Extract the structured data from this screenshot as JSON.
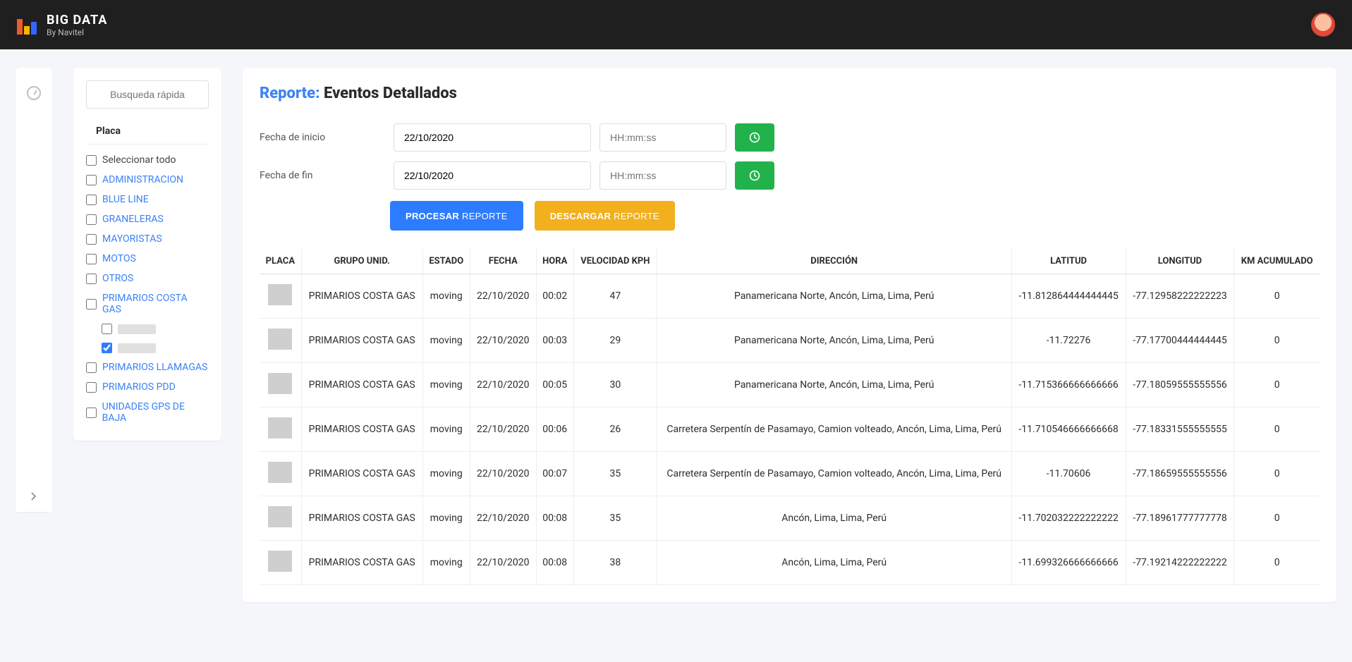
{
  "brand": {
    "title": "BIG DATA",
    "subtitle": "By Navitel"
  },
  "sidebar": {
    "search_placeholder": "Busqueda rápida",
    "section_title": "Placa",
    "items": [
      {
        "label": "Seleccionar todo",
        "checked": false,
        "plain": true
      },
      {
        "label": "ADMINISTRACION",
        "checked": false
      },
      {
        "label": "BLUE LINE",
        "checked": false
      },
      {
        "label": "GRANELERAS",
        "checked": false
      },
      {
        "label": "MAYORISTAS",
        "checked": false
      },
      {
        "label": "MOTOS",
        "checked": false
      },
      {
        "label": "OTROS",
        "checked": false
      },
      {
        "label": "PRIMARIOS COSTA GAS",
        "checked": false
      },
      {
        "label": "",
        "checked": false,
        "sub": true,
        "redacted": true,
        "redact_w": 54
      },
      {
        "label": "",
        "checked": true,
        "sub": true,
        "redacted": true,
        "redact_w": 54
      },
      {
        "label": "PRIMARIOS LLAMAGAS",
        "checked": false
      },
      {
        "label": "PRIMARIOS PDD",
        "checked": false
      },
      {
        "label": "UNIDADES GPS DE BAJA",
        "checked": false
      }
    ]
  },
  "report": {
    "title_pre": "Reporte:",
    "title_post": "Eventos Detallados",
    "start_label": "Fecha de inicio",
    "end_label": "Fecha de fin",
    "start_date": "22/10/2020",
    "end_date": "22/10/2020",
    "time_placeholder": "HH:mm:ss",
    "process_btn_bold": "PROCESAR",
    "process_btn_light": "REPORTE",
    "download_btn_bold": "DESCARGAR",
    "download_btn_light": "REPORTE"
  },
  "table": {
    "headers": [
      "PLACA",
      "GRUPO UNID.",
      "ESTADO",
      "FECHA",
      "HORA",
      "VELOCIDAD KPH",
      "DIRECCIÓN",
      "LATITUD",
      "LONGITUD",
      "KM ACUMULADO"
    ],
    "rows": [
      {
        "grupo": "PRIMARIOS COSTA GAS",
        "estado": "moving",
        "fecha": "22/10/2020",
        "hora": "00:02",
        "vel": "47",
        "dir": "Panamericana Norte, Ancón, Lima, Lima, Perú",
        "lat": "-11.812864444444445",
        "lon": "-77.12958222222223",
        "km": "0"
      },
      {
        "grupo": "PRIMARIOS COSTA GAS",
        "estado": "moving",
        "fecha": "22/10/2020",
        "hora": "00:03",
        "vel": "29",
        "dir": "Panamericana Norte, Ancón, Lima, Lima, Perú",
        "lat": "-11.72276",
        "lon": "-77.17700444444445",
        "km": "0"
      },
      {
        "grupo": "PRIMARIOS COSTA GAS",
        "estado": "moving",
        "fecha": "22/10/2020",
        "hora": "00:05",
        "vel": "30",
        "dir": "Panamericana Norte, Ancón, Lima, Lima, Perú",
        "lat": "-11.715366666666666",
        "lon": "-77.18059555555556",
        "km": "0"
      },
      {
        "grupo": "PRIMARIOS COSTA GAS",
        "estado": "moving",
        "fecha": "22/10/2020",
        "hora": "00:06",
        "vel": "26",
        "dir": "Carretera Serpentín de Pasamayo, Camion volteado, Ancón, Lima, Lima, Perú",
        "lat": "-11.710546666666668",
        "lon": "-77.18331555555555",
        "km": "0"
      },
      {
        "grupo": "PRIMARIOS COSTA GAS",
        "estado": "moving",
        "fecha": "22/10/2020",
        "hora": "00:07",
        "vel": "35",
        "dir": "Carretera Serpentín de Pasamayo, Camion volteado, Ancón, Lima, Lima, Perú",
        "lat": "-11.70606",
        "lon": "-77.18659555555556",
        "km": "0"
      },
      {
        "grupo": "PRIMARIOS COSTA GAS",
        "estado": "moving",
        "fecha": "22/10/2020",
        "hora": "00:08",
        "vel": "35",
        "dir": "Ancón, Lima, Lima, Perú",
        "lat": "-11.702032222222222",
        "lon": "-77.18961777777778",
        "km": "0"
      },
      {
        "grupo": "PRIMARIOS COSTA GAS",
        "estado": "moving",
        "fecha": "22/10/2020",
        "hora": "00:08",
        "vel": "38",
        "dir": "Ancón, Lima, Lima, Perú",
        "lat": "-11.699326666666666",
        "lon": "-77.19214222222222",
        "km": "0"
      }
    ]
  }
}
